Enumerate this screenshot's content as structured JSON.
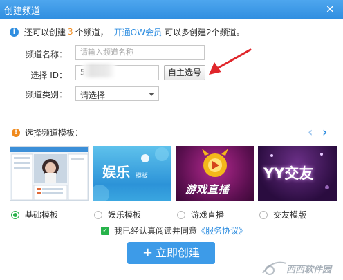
{
  "window": {
    "title": "创建频道",
    "close_glyph": "×"
  },
  "notice": {
    "prefix": "还可以创建",
    "count": "3",
    "middle": "个频道，",
    "link": "开通OW会员",
    "suffix": "可以多创建2个频道。"
  },
  "form": {
    "name_label": "频道名称：",
    "name_placeholder": "请输入频道名称",
    "id_label": "选择 ID：",
    "id_partial": "5",
    "self_select_button": "自主选号",
    "category_label": "频道类别：",
    "category_value": "请选择"
  },
  "templates": {
    "heading": "选择频道模板：",
    "prev_glyph": "‹",
    "next_glyph": "›",
    "items": [
      {
        "label": "基础模板",
        "selected": true,
        "thumb_text": ""
      },
      {
        "label": "娱乐模板",
        "selected": false,
        "thumb_text": "娱乐",
        "thumb_sub": "模板"
      },
      {
        "label": "游戏直播",
        "selected": false,
        "thumb_text": "游戏直播"
      },
      {
        "label": "交友模版",
        "selected": false,
        "thumb_text": "YY交友"
      }
    ]
  },
  "agreement": {
    "checked": true,
    "text": "我已经认真阅读并同意",
    "link": "《服务协议》"
  },
  "create_button": "立即创建",
  "watermark": "西西软件园",
  "colors": {
    "accent": "#2f8ee0",
    "orange": "#f08a1c",
    "green": "#27b34a",
    "arrow": "#e0262b"
  }
}
